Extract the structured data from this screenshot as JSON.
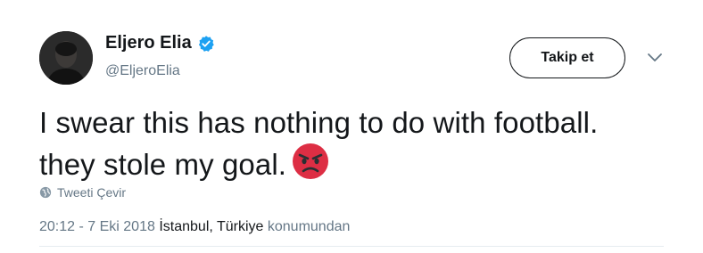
{
  "author": {
    "display_name": "Eljero Elia",
    "handle": "@EljeroElia",
    "verified": true
  },
  "follow_button": {
    "label": "Takip et"
  },
  "tweet": {
    "line1": "I swear this has nothing to do with football.",
    "line2": "they stole my goal.",
    "emoji": "pouting-face-emoji"
  },
  "translate": {
    "label": "Tweeti Çevir"
  },
  "meta": {
    "timestamp": "20:12 - 7 Eki 2018",
    "place": "İstanbul, Türkiye",
    "suffix": "konumundan"
  },
  "colors": {
    "text": "#14171a",
    "secondary": "#657786",
    "verified": "#1da1f2",
    "emoji_face": "#dd2e44"
  }
}
